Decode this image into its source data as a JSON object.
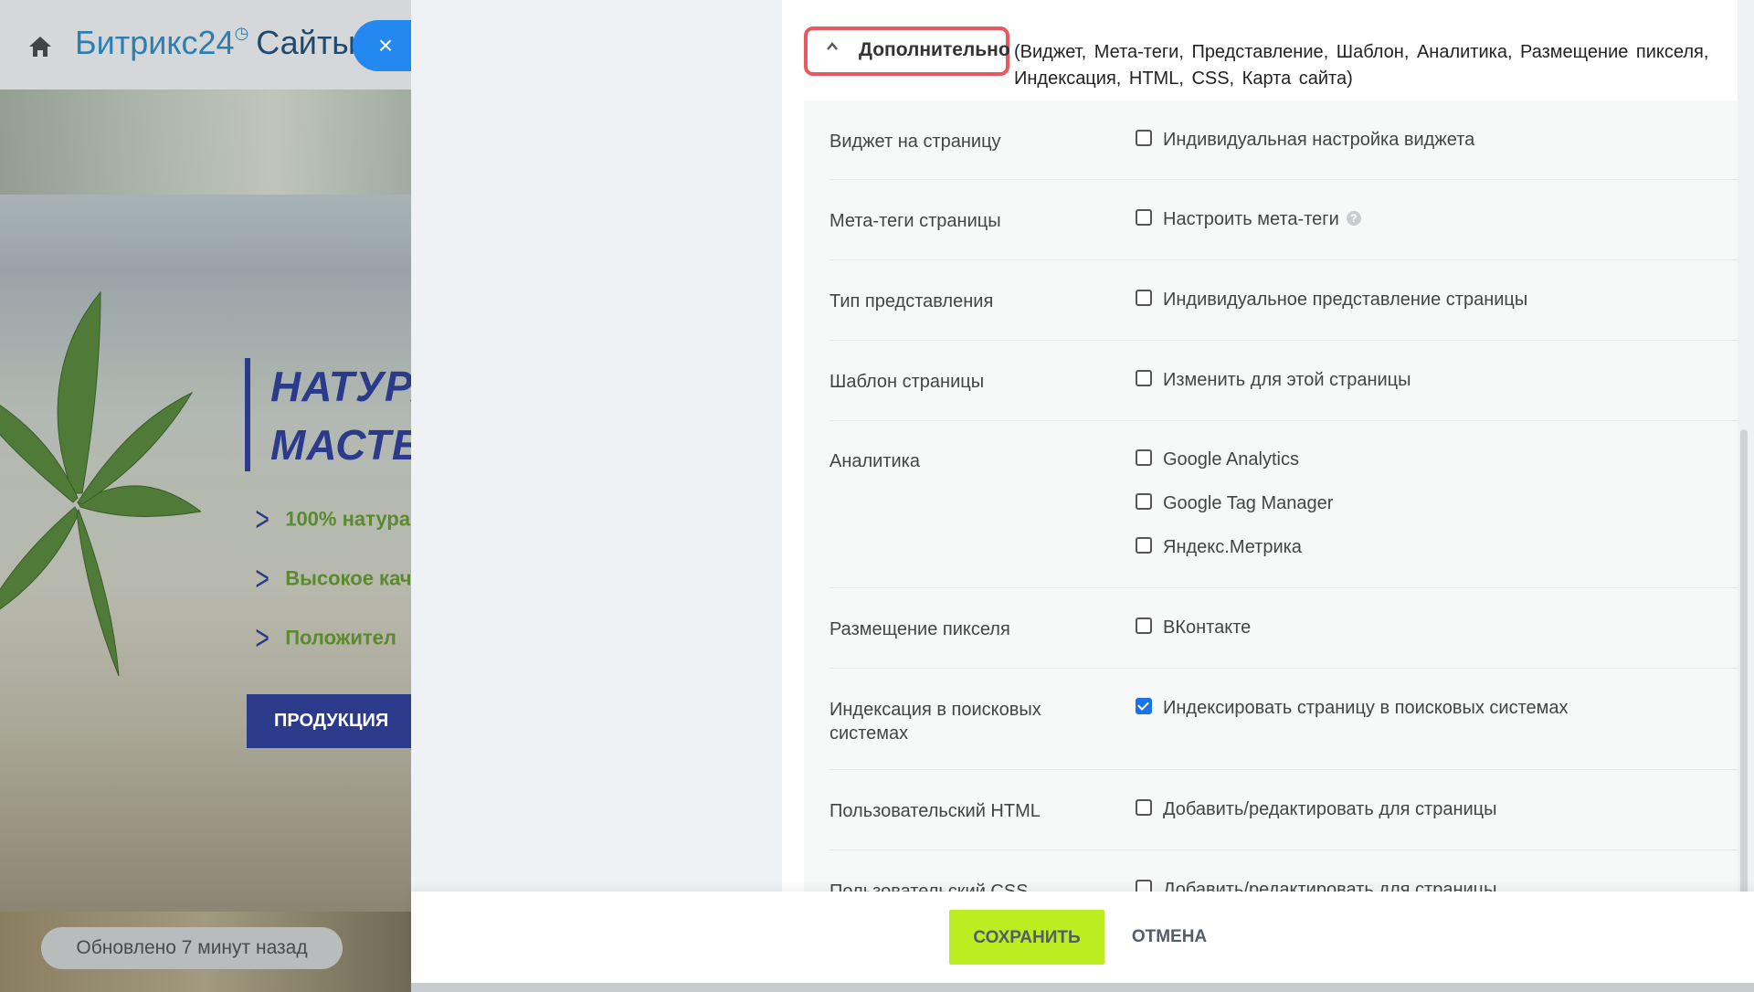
{
  "background": {
    "logo": {
      "brand": "Битрикс24",
      "clock_glyph": "◷",
      "product": "Сайты"
    },
    "close_glyph": "×",
    "hero": {
      "title_line1": "НАТУРА",
      "title_line2": "МАСТЕР",
      "features": [
        "100% натура",
        "Высокое кач",
        "Положител"
      ],
      "button": "ПРОДУКЦИЯ"
    },
    "updated_text": "Обновлено 7 минут назад"
  },
  "section": {
    "toggle_label": "Дополнительно",
    "toggle_desc": "(Виджет, Мета-теги, Представление, Шаблон, Аналитика, Размещение пикселя, Индексация, HTML, CSS, Карта сайта)"
  },
  "rows": [
    {
      "label": "Виджет на страницу",
      "options": [
        {
          "text": "Индивидуальная настройка виджета",
          "checked": false
        }
      ]
    },
    {
      "label": "Мета-теги страницы",
      "options": [
        {
          "text": "Настроить мета-теги",
          "checked": false,
          "help": true
        }
      ]
    },
    {
      "label": "Тип представления",
      "options": [
        {
          "text": "Индивидуальное представление страницы",
          "checked": false
        }
      ]
    },
    {
      "label": "Шаблон страницы",
      "options": [
        {
          "text": "Изменить для этой страницы",
          "checked": false
        }
      ]
    },
    {
      "label": "Аналитика",
      "options": [
        {
          "text": "Google Analytics",
          "checked": false
        },
        {
          "text": "Google Tag Manager",
          "checked": false
        },
        {
          "text": "Яндекс.Метрика",
          "checked": false
        }
      ]
    },
    {
      "label": "Размещение пикселя",
      "options": [
        {
          "text": "ВКонтакте",
          "checked": false
        }
      ]
    },
    {
      "label": "Индексация в поисковых системах",
      "options": [
        {
          "text": "Индексировать страницу в поисковых системах",
          "checked": true
        }
      ]
    },
    {
      "label": "Пользовательский HTML",
      "options": [
        {
          "text": "Добавить/редактировать для страницы",
          "checked": false
        }
      ]
    },
    {
      "label": "Пользовательский CSS",
      "options": [
        {
          "text": "Добавить/редактировать для страницы",
          "checked": false
        }
      ]
    }
  ],
  "footer": {
    "save": "СОХРАНИТЬ",
    "cancel": "ОТМЕНА"
  },
  "colors": {
    "accent_save": "#bbed21",
    "highlight": "#e8585f",
    "checkbox_checked": "#1a73e8"
  }
}
